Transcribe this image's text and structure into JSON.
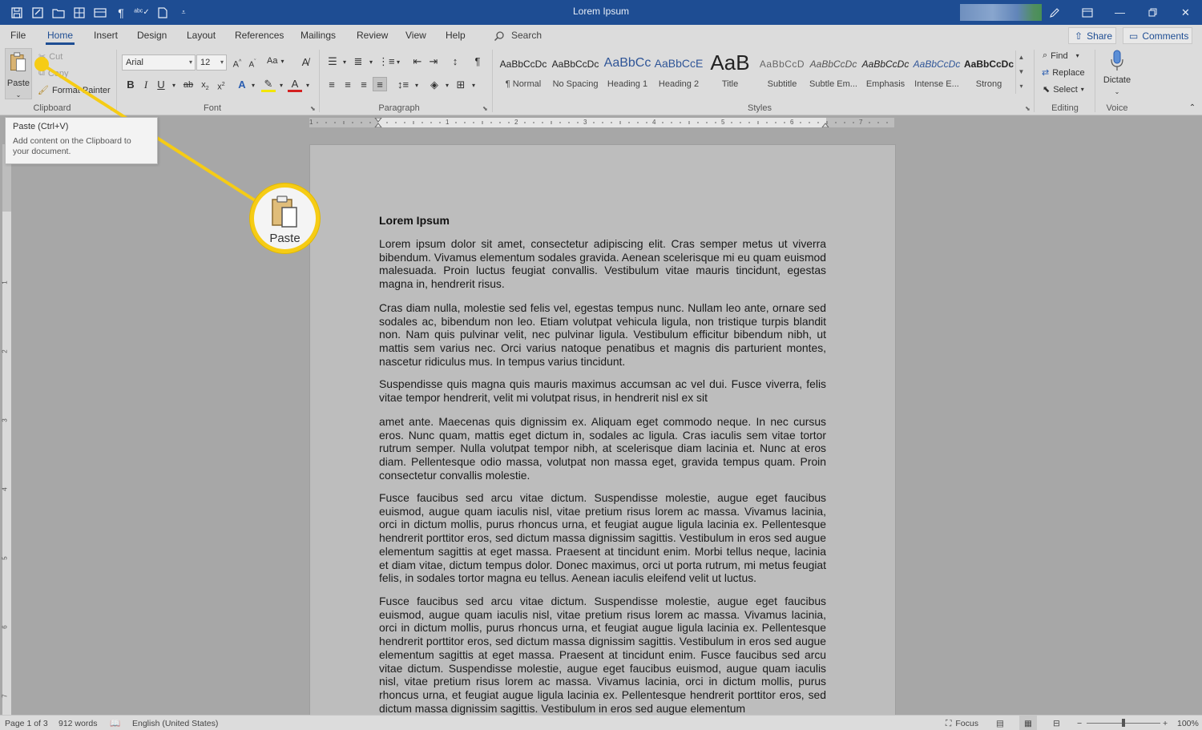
{
  "window": {
    "title": "Lorem Ipsum",
    "qat_icons": [
      "save-icon",
      "autosave-icon",
      "open-folder-icon",
      "layout-icon",
      "table-icon",
      "paragraph-marks-icon",
      "spelling-icon",
      "new-document-icon",
      "customize-qat-icon"
    ],
    "controls": [
      "pen-icon",
      "ribbon-display-icon",
      "minimize-icon",
      "restore-icon",
      "close-icon"
    ]
  },
  "menu": {
    "tabs": [
      "File",
      "Home",
      "Insert",
      "Design",
      "Layout",
      "References",
      "Mailings",
      "Review",
      "View",
      "Help"
    ],
    "active_tab": "Home",
    "search_label": "Search",
    "share_label": "Share",
    "comments_label": "Comments"
  },
  "ribbon": {
    "clipboard": {
      "label": "Clipboard",
      "paste": "Paste",
      "cut": "Cut",
      "copy": "Copy",
      "format_painter": "Format Painter"
    },
    "font": {
      "label": "Font",
      "font_name": "Arial",
      "font_size": "12",
      "case": "Aa"
    },
    "paragraph": {
      "label": "Paragraph"
    },
    "styles": {
      "label": "Styles",
      "items": [
        {
          "sample": "AaBbCcDc",
          "name": "¶ Normal"
        },
        {
          "sample": "AaBbCcDc",
          "name": "No Spacing"
        },
        {
          "sample": "AaBbCc",
          "name": "Heading 1"
        },
        {
          "sample": "AaBbCcE",
          "name": "Heading 2"
        },
        {
          "sample": "AaB",
          "name": "Title"
        },
        {
          "sample": "AaBbCcD",
          "name": "Subtitle"
        },
        {
          "sample": "AaBbCcDc",
          "name": "Subtle Em..."
        },
        {
          "sample": "AaBbCcDc",
          "name": "Emphasis"
        },
        {
          "sample": "AaBbCcDc",
          "name": "Intense E..."
        },
        {
          "sample": "AaBbCcDc",
          "name": "Strong"
        }
      ]
    },
    "editing": {
      "label": "Editing",
      "find": "Find",
      "replace": "Replace",
      "select": "Select"
    },
    "voice": {
      "label": "Voice",
      "dictate": "Dictate"
    }
  },
  "tooltip": {
    "title": "Paste (Ctrl+V)",
    "body": "Add content on the Clipboard to your document."
  },
  "callout": {
    "label": "Paste"
  },
  "ruler": {
    "marks": [
      "1",
      "1",
      "2",
      "3",
      "4",
      "5",
      "6",
      "7"
    ],
    "vmarks": [
      "1",
      "2",
      "3",
      "4",
      "5",
      "6",
      "7"
    ]
  },
  "document": {
    "heading": "Lorem Ipsum",
    "paragraphs": [
      "Lorem ipsum dolor sit amet, consectetur adipiscing elit. Cras semper metus ut viverra bibendum. Vivamus elementum sodales gravida. Aenean scelerisque mi eu quam euismod malesuada. Proin luctus feugiat convallis. Vestibulum vitae mauris tincidunt, egestas magna in, hendrerit risus.",
      "Cras diam nulla, molestie sed felis vel, egestas tempus nunc. Nullam leo ante, ornare sed sodales ac, bibendum non leo. Etiam volutpat vehicula ligula, non tristique turpis blandit non. Nam quis pulvinar velit, nec pulvinar ligula. Vestibulum efficitur bibendum nibh, ut mattis sem varius nec. Orci varius natoque penatibus et magnis dis parturient montes, nascetur ridiculus mus. In tempus varius tincidunt.",
      "Suspendisse quis magna quis mauris maximus accumsan ac vel dui. Fusce viverra, felis vitae tempor hendrerit, velit mi volutpat risus, in hendrerit nisl ex sit",
      "amet ante. Maecenas quis dignissim ex. Aliquam eget commodo neque. In nec cursus eros. Nunc quam, mattis eget dictum in, sodales ac ligula. Cras iaculis sem vitae tortor rutrum semper. Nulla volutpat tempor nibh, at scelerisque diam lacinia et. Nunc at eros diam. Pellentesque odio massa, volutpat non massa eget, gravida tempus quam. Proin consectetur convallis molestie.",
      "Fusce faucibus sed arcu vitae dictum. Suspendisse molestie, augue eget faucibus euismod, augue quam iaculis nisl, vitae pretium risus lorem ac massa. Vivamus lacinia, orci in dictum mollis, purus rhoncus urna, et feugiat augue ligula lacinia ex. Pellentesque hendrerit porttitor eros, sed dictum massa dignissim sagittis. Vestibulum in eros sed augue elementum sagittis at eget massa. Praesent at tincidunt enim. Morbi tellus neque, lacinia et diam vitae, dictum tempus dolor. Donec maximus, orci ut porta rutrum, mi metus feugiat felis, in sodales tortor magna eu tellus. Aenean iaculis eleifend velit ut luctus.",
      "Fusce faucibus sed arcu vitae dictum. Suspendisse molestie, augue eget faucibus euismod, augue quam iaculis nisl, vitae pretium risus lorem ac massa. Vivamus lacinia, orci in dictum mollis, purus rhoncus urna, et feugiat augue ligula lacinia ex. Pellentesque hendrerit porttitor eros, sed dictum massa dignissim sagittis. Vestibulum in eros sed augue elementum sagittis at eget massa. Praesent at tincidunt enim. Fusce faucibus sed arcu vitae dictum. Suspendisse molestie, augue eget faucibus euismod, augue quam iaculis nisl, vitae pretium risus lorem ac massa. Vivamus lacinia, orci in dictum mollis, purus rhoncus urna, et feugiat augue ligula lacinia ex. Pellentesque hendrerit porttitor eros, sed dictum massa dignissim sagittis. Vestibulum in eros sed augue elementum"
    ]
  },
  "status": {
    "page": "Page 1 of 3",
    "words": "912 words",
    "language": "English (United States)",
    "focus": "Focus",
    "zoom": "100%"
  },
  "colors": {
    "title_bar": "#1e4d93",
    "ribbon": "#dcdcdc",
    "callout": "#f6cc15",
    "canvas": "#a7a7a7"
  }
}
